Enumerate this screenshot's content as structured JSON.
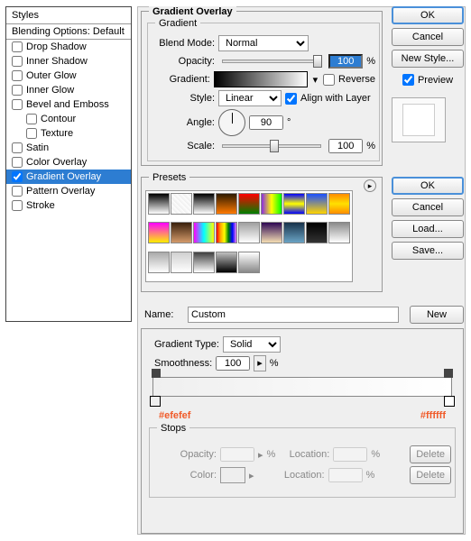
{
  "styles_panel": {
    "title": "Styles",
    "blending_options": "Blending Options: Default",
    "items": [
      {
        "label": "Drop Shadow",
        "checked": false,
        "indent": false
      },
      {
        "label": "Inner Shadow",
        "checked": false,
        "indent": false
      },
      {
        "label": "Outer Glow",
        "checked": false,
        "indent": false
      },
      {
        "label": "Inner Glow",
        "checked": false,
        "indent": false
      },
      {
        "label": "Bevel and Emboss",
        "checked": false,
        "indent": false
      },
      {
        "label": "Contour",
        "checked": false,
        "indent": true
      },
      {
        "label": "Texture",
        "checked": false,
        "indent": true
      },
      {
        "label": "Satin",
        "checked": false,
        "indent": false
      },
      {
        "label": "Color Overlay",
        "checked": false,
        "indent": false
      },
      {
        "label": "Gradient Overlay",
        "checked": true,
        "indent": false,
        "selected": true
      },
      {
        "label": "Pattern Overlay",
        "checked": false,
        "indent": false
      },
      {
        "label": "Stroke",
        "checked": false,
        "indent": false
      }
    ]
  },
  "gradient_overlay": {
    "group_title": "Gradient Overlay",
    "sub_title": "Gradient",
    "blend_mode_label": "Blend Mode:",
    "blend_mode_value": "Normal",
    "opacity_label": "Opacity:",
    "opacity_value": "100",
    "percent": "%",
    "gradient_label": "Gradient:",
    "reverse_label": "Reverse",
    "reverse_checked": false,
    "style_label": "Style:",
    "style_value": "Linear",
    "align_label": "Align with Layer",
    "align_checked": true,
    "angle_label": "Angle:",
    "angle_value": "90",
    "degree": "°",
    "scale_label": "Scale:",
    "scale_value": "100"
  },
  "right_buttons_1": {
    "ok": "OK",
    "cancel": "Cancel",
    "new_style": "New Style...",
    "preview_label": "Preview",
    "preview_checked": true
  },
  "editor": {
    "presets_title": "Presets",
    "name_label": "Name:",
    "name_value": "Custom",
    "new_btn": "New",
    "type_label": "Gradient Type:",
    "type_value": "Solid",
    "smoothness_label": "Smoothness:",
    "smoothness_value": "100",
    "percent": "%",
    "left_hex": "#efefef",
    "right_hex": "#ffffff",
    "stops_title": "Stops",
    "stop_opacity_label": "Opacity:",
    "stop_location_label": "Location:",
    "stop_color_label": "Color:",
    "delete_btn": "Delete"
  },
  "right_buttons_2": {
    "ok": "OK",
    "cancel": "Cancel",
    "load": "Load...",
    "save": "Save..."
  },
  "preset_gradients": [
    "linear-gradient(#000,#fff)",
    "repeating-linear-gradient(45deg,#eee,#fff 4px)",
    "linear-gradient(#000,rgba(0,0,0,0))",
    "linear-gradient(#2d1a00,#ff7a00)",
    "linear-gradient(#ff0000,#008000)",
    "linear-gradient(to right,#8a2be2,#ff0,#0f0)",
    "linear-gradient(#00f,#ff0,#00f)",
    "linear-gradient(#1b4fff,#ffd400)",
    "linear-gradient(#ff8c00,#ffe000,#ff8c00)",
    "linear-gradient(#ff00ff,#ffef00)",
    "linear-gradient(#3a1f0b,#d49a6a)",
    "linear-gradient(to right,#f0f,#0ff,#ff0)",
    "linear-gradient(to right,red,orange,yellow,green,blue,violet)",
    "linear-gradient(#a0a0a0,#fff)",
    "linear-gradient(#2e0854,#f5deb3)",
    "linear-gradient(#18324a,#6aa3c4)",
    "linear-gradient(#000,#333)",
    "linear-gradient(#8a8a8a,#fff)",
    "linear-gradient(#a9a9a9,#fff)",
    "linear-gradient(#d0d0d0,#fff)",
    "linear-gradient(#404040,#fff)",
    "linear-gradient(#c0c0c0,#000)",
    "linear-gradient(#fff,#888)"
  ]
}
